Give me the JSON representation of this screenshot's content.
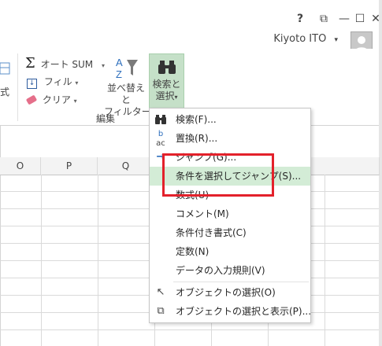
{
  "titlebar": {
    "help": "?",
    "ribbon_options": "⧉",
    "minimize": "—",
    "maximize": "☐",
    "close": "✕",
    "user_name": "Kiyoto ITO",
    "user_caret": "▾"
  },
  "ribbon": {
    "partial_left": "式",
    "autosum_label": "オート SUM",
    "fill_label": "フィル",
    "clear_label": "クリア",
    "sort_filter_line1": "並べ替えと",
    "sort_filter_line2": "フィルター",
    "find_select_line1": "検索と",
    "find_select_line2": "選択",
    "group_label": "編集",
    "caret": "▾"
  },
  "columns": [
    "O",
    "P",
    "Q"
  ],
  "menu": {
    "items": [
      {
        "icon": "binoculars-icon",
        "glyph": "🔭",
        "label": "検索(F)..."
      },
      {
        "icon": "replace-icon",
        "glyph": "ac",
        "label": "置換(R)..."
      },
      {
        "icon": "goto-arrow-icon",
        "glyph": "→",
        "label": "ジャンプ(G)..."
      },
      {
        "icon": "",
        "glyph": "",
        "label": "条件を選択してジャンプ(S)..."
      },
      {
        "icon": "",
        "glyph": "",
        "label": "数式(U)"
      },
      {
        "icon": "",
        "glyph": "",
        "label": "コメント(M)"
      },
      {
        "icon": "",
        "glyph": "",
        "label": "条件付き書式(C)"
      },
      {
        "icon": "",
        "glyph": "",
        "label": "定数(N)"
      },
      {
        "icon": "",
        "glyph": "",
        "label": "データの入力規則(V)"
      },
      {
        "icon": "select-objects-icon",
        "glyph": "↖",
        "label": "オブジェクトの選択(O)"
      },
      {
        "icon": "selection-pane-icon",
        "glyph": "⧉",
        "label": "オブジェクトの選択と表示(P)..."
      }
    ]
  },
  "colors": {
    "highlight": "#d3ecd6",
    "active_button": "#c5e0c8",
    "annotation_box": "#e3212b"
  }
}
